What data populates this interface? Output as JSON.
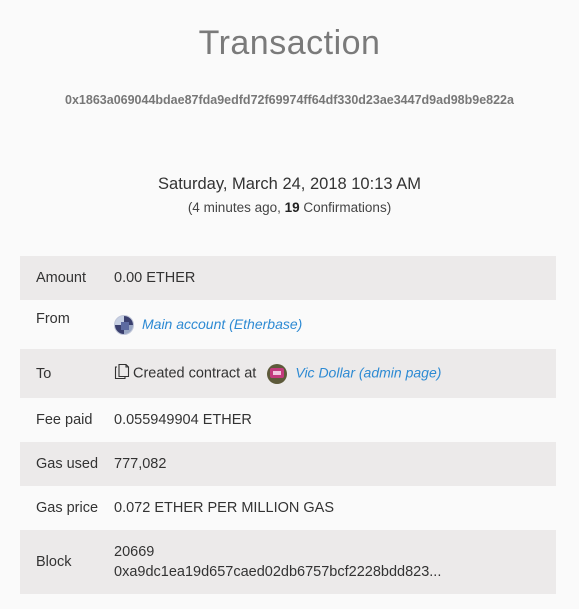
{
  "page": {
    "title": "Transaction",
    "hash": "0x1863a069044bdae87fda9edfd72f69974ff64df330d23ae3447d9ad98b9e822a",
    "date": "Saturday, March 24, 2018 10:13 AM",
    "ago_prefix": "(4 minutes ago, ",
    "confirmations": "19",
    "ago_suffix": " Confirmations)"
  },
  "details": {
    "amount": {
      "label": "Amount",
      "value": "0.00 ETHER"
    },
    "from": {
      "label": "From",
      "account": "Main account (Etherbase)",
      "icon": "identicon-avatar"
    },
    "to": {
      "label": "To",
      "icon": "document-icon",
      "created_text": "Created contract at",
      "contract": "Vic Dollar (admin page)",
      "contract_icon": "identicon-avatar"
    },
    "fee": {
      "label": "Fee paid",
      "value": "0.055949904 ETHER"
    },
    "gas_used": {
      "label": "Gas used",
      "value": "777,082"
    },
    "gas_price": {
      "label": "Gas price",
      "value": "0.072 ETHER PER MILLION GAS"
    },
    "block": {
      "label": "Block",
      "number": "20669",
      "hash": "0xa9dc1ea19d657caed02db6757bcf2228bdd823..."
    }
  },
  "colors": {
    "link": "#2d8ad3",
    "shaded_row": "#eceaea",
    "background": "#fafafa",
    "title": "#7a7a7a"
  }
}
